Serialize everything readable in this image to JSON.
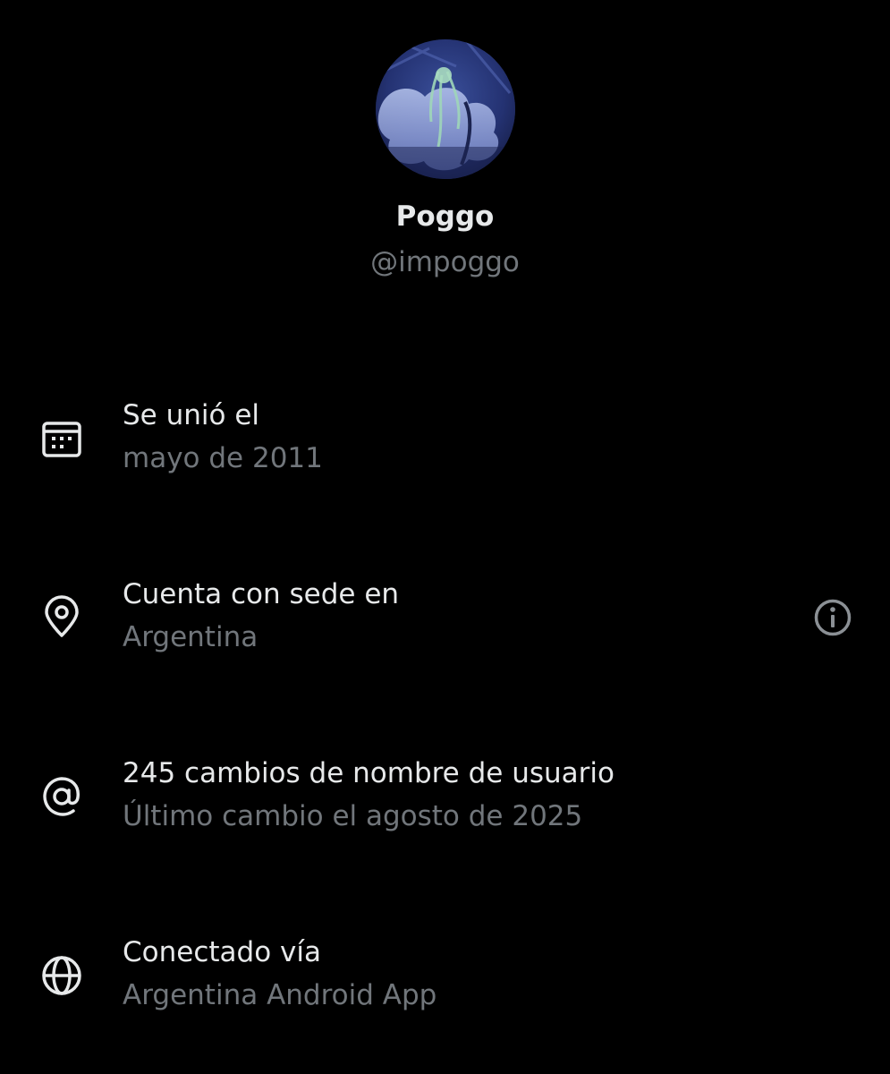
{
  "profile": {
    "display_name": "Poggo",
    "handle": "@impoggo"
  },
  "rows": [
    {
      "icon": "calendar-icon",
      "title": "Se unió el",
      "subtitle": "mayo de 2011"
    },
    {
      "icon": "location-pin-icon",
      "title": "Cuenta con sede en",
      "subtitle": "Argentina",
      "trailing_icon": "info-icon"
    },
    {
      "icon": "at-sign-icon",
      "title": "245 cambios de nombre de usuario",
      "subtitle": "Último cambio el agosto de 2025"
    },
    {
      "icon": "globe-icon",
      "title": "Conectado vía",
      "subtitle": "Argentina Android App"
    }
  ],
  "colors": {
    "background": "#000000",
    "primary_text": "#e7e9ea",
    "secondary_text": "#71767b"
  }
}
